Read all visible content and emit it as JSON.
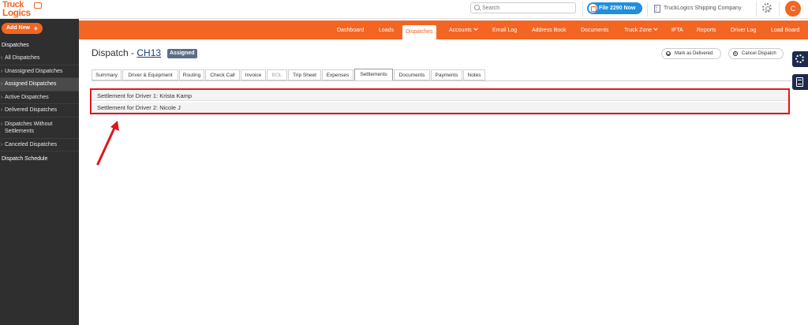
{
  "header": {
    "logo_line1": "Truck",
    "logo_line2": "Logics",
    "search_placeholder": "Search",
    "file2290_label": "File 2290 Now",
    "company_name": "TruckLogics Shipping Company",
    "avatar_initial": "C"
  },
  "sidebar": {
    "add_new_label": "Add New",
    "section_title": "Dispatches",
    "items": [
      {
        "label": "All Dispatches"
      },
      {
        "label": "Unassigned Dispatches"
      },
      {
        "label": "Assigned Dispatches",
        "active": true
      },
      {
        "label": "Active Dispatches"
      },
      {
        "label": "Delivered Dispatches"
      },
      {
        "label": "Dispatches Without Settlements"
      },
      {
        "label": "Canceled Dispatches"
      }
    ],
    "bottom_item": "Dispatch Schedule"
  },
  "nav": {
    "items": [
      {
        "label": "Dashboard"
      },
      {
        "label": "Loads"
      },
      {
        "label": "Dispatches",
        "active": true
      },
      {
        "label": "Accounts",
        "dropdown": true
      },
      {
        "label": "Email Log"
      },
      {
        "label": "Address Book"
      },
      {
        "label": "Documents"
      },
      {
        "label": "Truck Zone",
        "dropdown": true
      },
      {
        "label": "IFTA"
      },
      {
        "label": "Reports"
      },
      {
        "label": "Driver Log"
      },
      {
        "label": "Load Board"
      }
    ]
  },
  "page": {
    "title_prefix": "Dispatch - ",
    "dispatch_number": "CH13",
    "status": "Assigned",
    "mark_delivered_label": "Mark as Delivered",
    "cancel_dispatch_label": "Cancel Dispatch"
  },
  "tabs": [
    {
      "label": "Summary"
    },
    {
      "label": "Driver & Equipment"
    },
    {
      "label": "Routing"
    },
    {
      "label": "Check Call"
    },
    {
      "label": "Invoice"
    },
    {
      "label": "BOL",
      "disabled": true
    },
    {
      "label": "Trip Sheet"
    },
    {
      "label": "Expenses"
    },
    {
      "label": "Settlements",
      "active": true
    },
    {
      "label": "Documents"
    },
    {
      "label": "Payments"
    },
    {
      "label": "Notes"
    }
  ],
  "settlements": [
    "Settlement for Driver 1: Krista Kamp",
    "Settlement for Driver 2: Nicole J"
  ],
  "colors": {
    "brand_orange": "#f26522",
    "sidebar_bg": "#2f2f2f",
    "highlight_red": "#e3141c",
    "status_badge": "#5b6e84"
  }
}
